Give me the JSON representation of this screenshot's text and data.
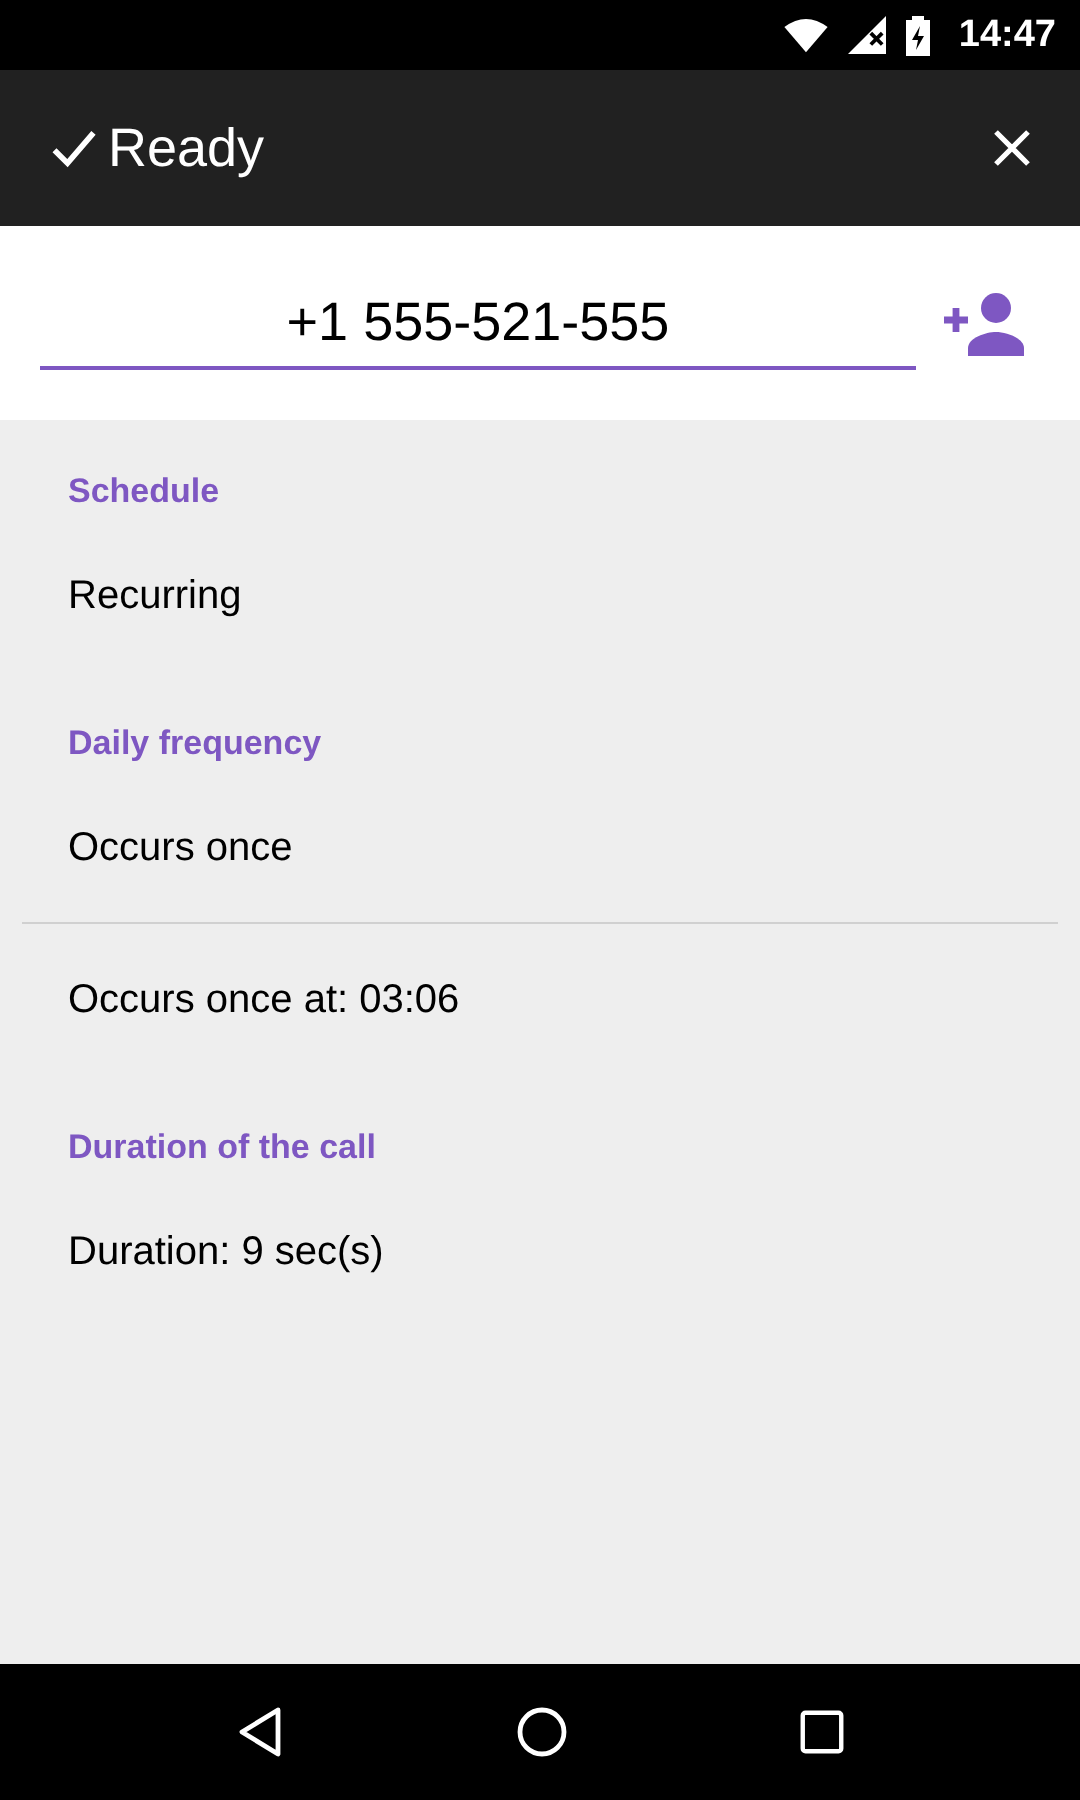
{
  "status_bar": {
    "time": "14:47"
  },
  "app_bar": {
    "title": "Ready"
  },
  "phone_field": {
    "value": "+1 555-521-555"
  },
  "rows": [
    {
      "kind": "header",
      "text": "Schedule"
    },
    {
      "kind": "item",
      "text": "Recurring"
    },
    {
      "kind": "header",
      "text": "Daily frequency"
    },
    {
      "kind": "item",
      "text": "Occurs once"
    },
    {
      "kind": "divider"
    },
    {
      "kind": "item",
      "text": "Occurs once at: 03:06"
    },
    {
      "kind": "header",
      "text": "Duration of the call"
    },
    {
      "kind": "item",
      "text": "Duration: 9 sec(s)"
    }
  ]
}
